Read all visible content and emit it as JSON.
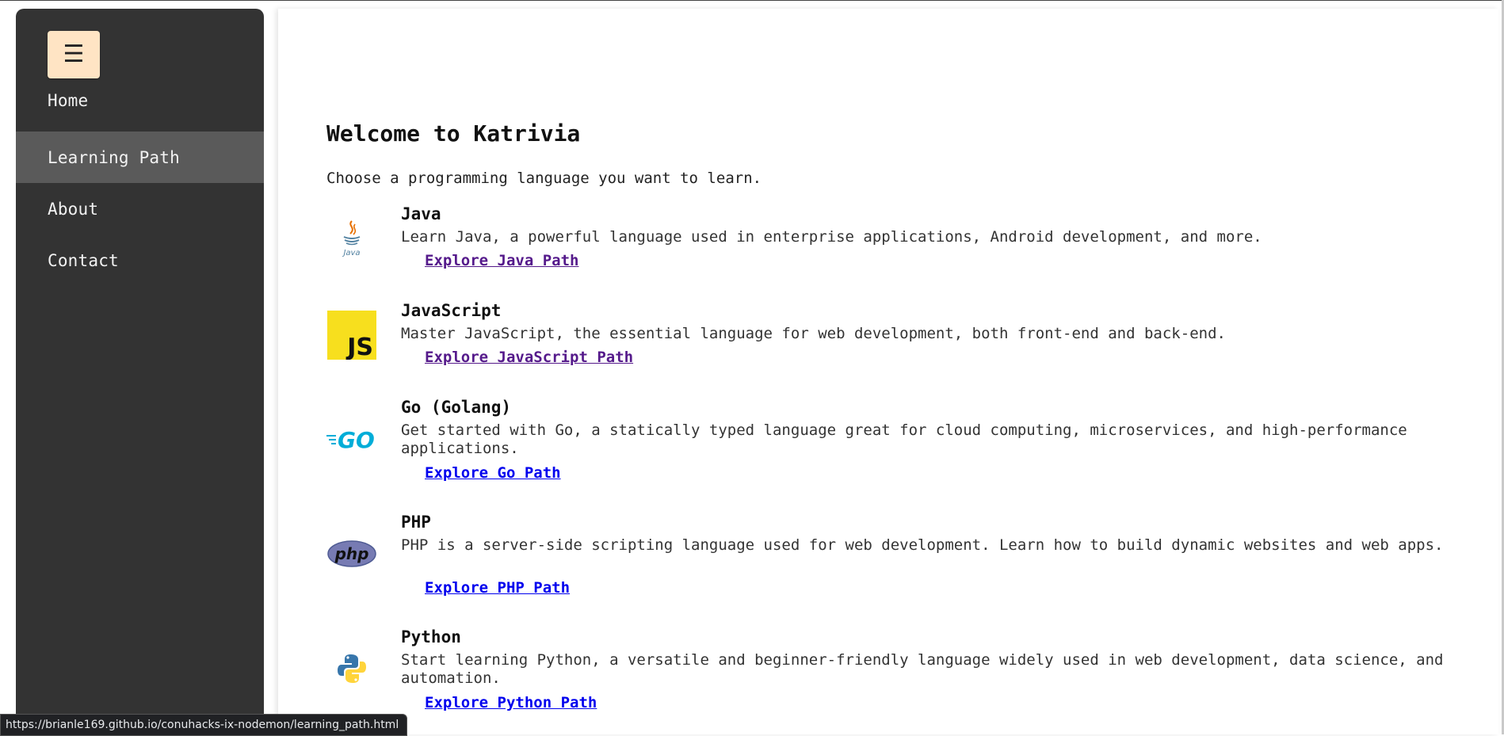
{
  "sidebar": {
    "menu_icon": "hamburger-menu-icon",
    "menu_glyph": "☰",
    "items": [
      {
        "label": "Home"
      },
      {
        "label": "Learning Path"
      },
      {
        "label": "About"
      },
      {
        "label": "Contact"
      }
    ],
    "active": "Learning Path",
    "background": "#333333",
    "menu_button_color": "#ffe4c4"
  },
  "main": {
    "title": "Welcome to Katrivia",
    "intro": "Choose a programming language you want to learn.",
    "languages": [
      {
        "name": "Java",
        "description": "Learn Java, a powerful language used in enterprise applications, Android development, and more.",
        "link": "Explore Java Path",
        "icon": "java-logo-icon",
        "logo_text": "Java",
        "visited": true
      },
      {
        "name": "JavaScript",
        "description": "Master JavaScript, the essential language for web development, both front-end and back-end.",
        "link": "Explore JavaScript Path",
        "icon": "javascript-logo-icon",
        "logo_text": "JS",
        "visited": true
      },
      {
        "name": "Go (Golang)",
        "description": "Get started with Go, a statically typed language great for cloud computing, microservices, and high-performance applications.",
        "link": "Explore Go Path",
        "icon": "go-logo-icon",
        "logo_text": "GO",
        "visited": false
      },
      {
        "name": "PHP",
        "description": "PHP is a server-side scripting language used for web development. Learn how to build dynamic websites and web apps.",
        "link": "Explore PHP Path",
        "icon": "php-logo-icon",
        "logo_text": "php",
        "visited": false
      },
      {
        "name": "Python",
        "description": "Start learning Python, a versatile and beginner-friendly language widely used in web development, data science, and automation.",
        "link": "Explore Python Path",
        "icon": "python-logo-icon",
        "visited": false
      }
    ],
    "link_colors": {
      "visited": "#551a8b",
      "unvisited": "#0000ee"
    }
  },
  "status_bar": {
    "url": "https://brianle169.github.io/conuhacks-ix-nodemon/learning_path.html"
  }
}
